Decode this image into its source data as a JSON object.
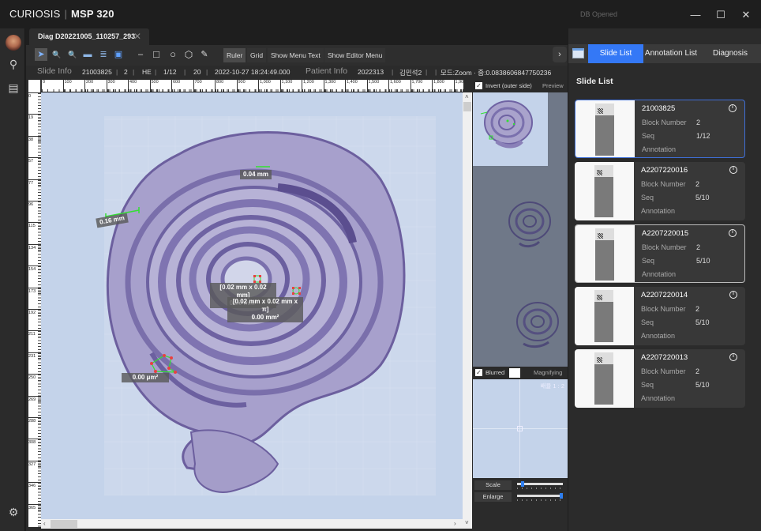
{
  "window": {
    "brand_name": "CURIOSIS",
    "product": "MSP 320",
    "db_status": "DB Opened",
    "minimize_glyph": "—",
    "maximize_glyph": "☐",
    "close_glyph": "✕"
  },
  "leftbar": {
    "items": [
      {
        "name": "avatar",
        "glyph": ""
      },
      {
        "name": "search-icon",
        "glyph": "⚲"
      },
      {
        "name": "report-icon",
        "glyph": "▤"
      },
      {
        "name": "settings-icon",
        "glyph": "⚙"
      }
    ]
  },
  "tab": {
    "label": "Diag D20221005_110257_293",
    "close_glyph": "✕"
  },
  "toolbar": {
    "tools": [
      {
        "name": "pointer-tool",
        "glyph": "➤"
      },
      {
        "name": "zoom-in-tool",
        "glyph": "🔍"
      },
      {
        "name": "zoom-out-tool",
        "glyph": "🔍"
      },
      {
        "name": "capture-tool",
        "glyph": "▬"
      },
      {
        "name": "layout-tool",
        "glyph": "≣"
      },
      {
        "name": "fit-tool",
        "glyph": "▣"
      },
      {
        "name": "line-tool",
        "glyph": "–"
      },
      {
        "name": "rectangle-tool",
        "glyph": "□"
      },
      {
        "name": "circle-tool",
        "glyph": "○"
      },
      {
        "name": "polygon-tool",
        "glyph": "⬡"
      },
      {
        "name": "edit-tool",
        "glyph": "✎"
      }
    ],
    "ruler_label": "Ruler",
    "grid_label": "Grid",
    "show_menu_text_label": "Show Menu Text",
    "show_editor_menu_label": "Show Editor Menu",
    "collapse_glyph": "›"
  },
  "infobar": {
    "slide_info_label": "Slide Info",
    "slide_id": "21003825",
    "block": "2",
    "stain": "HE",
    "seq": "1/12",
    "magnification": "20",
    "datetime": "2022-10-27 18:24:49.000",
    "patient_info_label": "Patient Info",
    "patient_id": "2022313",
    "patient_name": "김민석2",
    "mode": "모드:Zoom · 줌:0.0838606847750236",
    "separator": "|"
  },
  "ruler": {
    "horizontal": [
      "0",
      "100",
      "200",
      "300",
      "400",
      "500",
      "600",
      "700",
      "800",
      "900",
      "1,000",
      "1,100",
      "1,200",
      "1,300",
      "1,400",
      "1,500",
      "1,600",
      "1,700",
      "1,800",
      "1,900"
    ],
    "vertical": [
      "0",
      "19",
      "38",
      "57",
      "77",
      "96",
      "115",
      "134",
      "154",
      "173",
      "192",
      "211",
      "231",
      "250",
      "269",
      "288",
      "308",
      "327",
      "346",
      "365"
    ]
  },
  "annotations": [
    {
      "label": "0.04 mm"
    },
    {
      "label": "0.16 mm"
    },
    {
      "label": "[0.02 mm x 0.02 mm]",
      "sub": "0.00 mm²"
    },
    {
      "label": "[0.02 mm x 0.02 mm x π]",
      "sub": "0.00 mm²"
    },
    {
      "label": "0.00 μm²"
    }
  ],
  "side": {
    "invert_label": "Invert (outer side)",
    "invert_checked": true,
    "preview_label": "Preview",
    "blurred_label": "Blurred",
    "blurred_checked": true,
    "magnifying_label": "Magnifying",
    "magnify_ratio": "배율 1 : 2",
    "scale_label": "Scale",
    "scale_value": 0.1,
    "enlarge_label": "Enlarge",
    "enlarge_value": 1.0
  },
  "rpanel": {
    "tabs": [
      "Slide List",
      "Annotation List",
      "Diagnosis"
    ],
    "active_tab": "Slide List",
    "title": "Slide List",
    "accent": "#3478f6",
    "field_labels": {
      "block": "Block Number",
      "seq": "Seq",
      "annotation": "Annotation"
    },
    "slides": [
      {
        "id": "21003825",
        "block": "2",
        "seq": "1/12",
        "state": "selected"
      },
      {
        "id": "A2207220016",
        "block": "2",
        "seq": "5/10",
        "state": ""
      },
      {
        "id": "A2207220015",
        "block": "2",
        "seq": "5/10",
        "state": "hover"
      },
      {
        "id": "A2207220014",
        "block": "2",
        "seq": "5/10",
        "state": ""
      },
      {
        "id": "A2207220013",
        "block": "2",
        "seq": "5/10",
        "state": ""
      }
    ]
  }
}
